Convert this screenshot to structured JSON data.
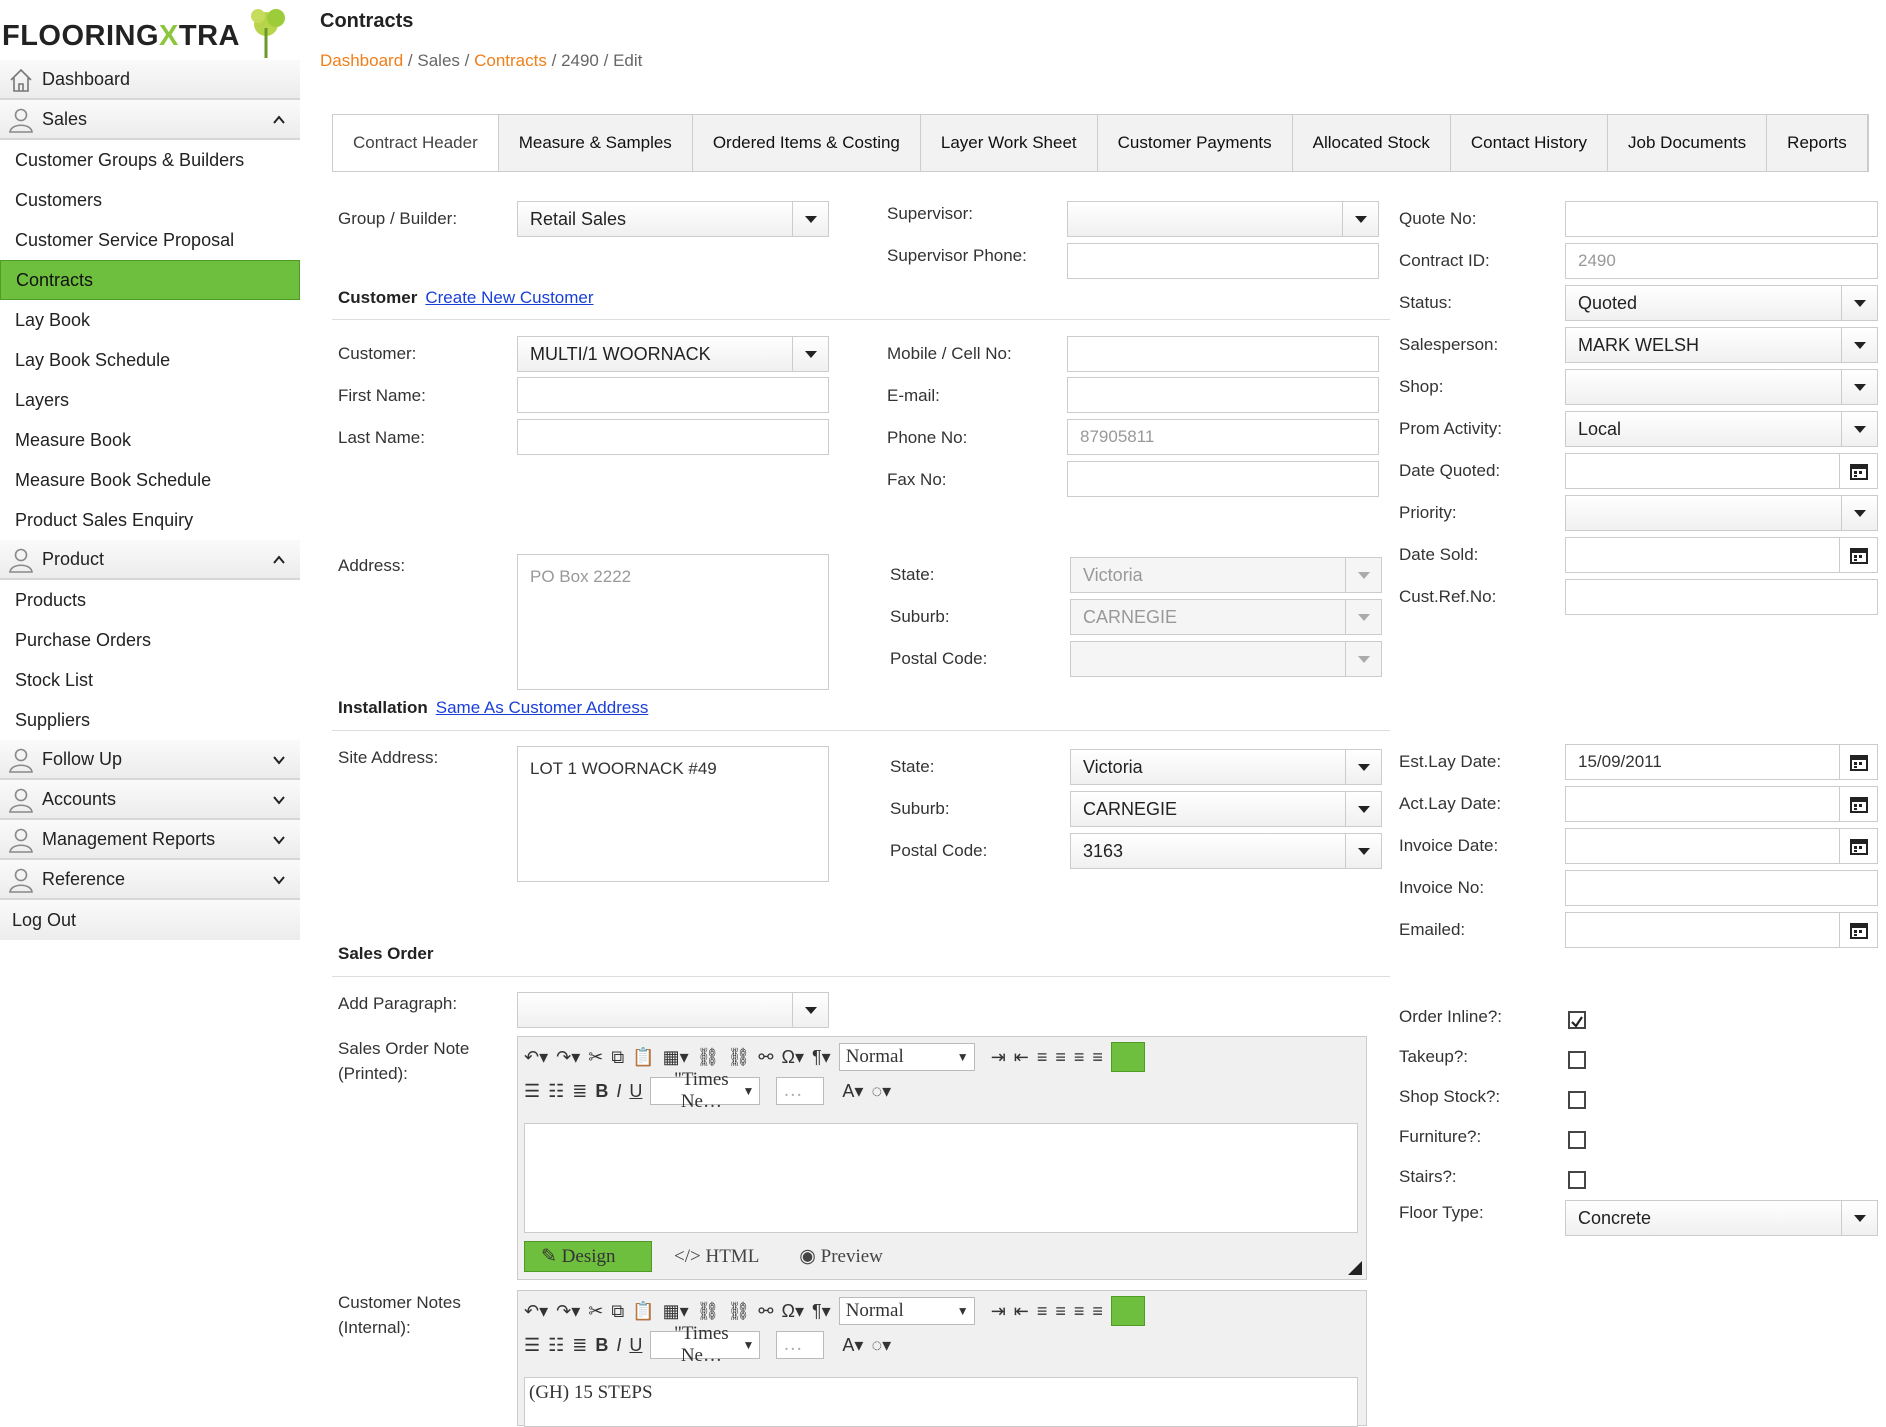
{
  "logo": {
    "part1": "FLOORING",
    "part2": "X",
    "part3": "TRA"
  },
  "nav": {
    "dashboard": "Dashboard",
    "sales": "Sales",
    "sales_items": [
      "Customer Groups & Builders",
      "Customers",
      "Customer Service Proposal",
      "Contracts",
      "Lay Book",
      "Lay Book Schedule",
      "Layers",
      "Measure Book",
      "Measure Book Schedule",
      "Product Sales Enquiry"
    ],
    "product": "Product",
    "product_items": [
      "Products",
      "Purchase Orders",
      "Stock List",
      "Suppliers"
    ],
    "follow_up": "Follow Up",
    "accounts": "Accounts",
    "management_reports": "Management Reports",
    "reference": "Reference",
    "logout": "Log Out"
  },
  "page": {
    "title": "Contracts"
  },
  "breadcrumb": {
    "dashboard": "Dashboard",
    "sep": "/",
    "sales": "Sales",
    "contracts": "Contracts",
    "id": "2490",
    "edit": "Edit"
  },
  "tabs": [
    "Contract Header",
    "Measure & Samples",
    "Ordered Items & Costing",
    "Layer Work Sheet",
    "Customer Payments",
    "Allocated Stock",
    "Contact History",
    "Job Documents",
    "Reports"
  ],
  "form": {
    "group_label": "Group / Builder:",
    "group_value": "Retail Sales",
    "supervisor_label": "Supervisor:",
    "supervisor_value": "",
    "supervisor_phone_label": "Supervisor Phone:",
    "supervisor_phone_value": "",
    "customer_section": "Customer",
    "create_customer_link": "Create New Customer",
    "customer_label": "Customer:",
    "customer_value": "MULTI/1 WOORNACK",
    "first_name_label": "First Name:",
    "first_name_value": "",
    "last_name_label": "Last Name:",
    "last_name_value": "",
    "mobile_label": "Mobile / Cell No:",
    "mobile_value": "",
    "email_label": "E-mail:",
    "email_value": "",
    "phone_label": "Phone No:",
    "phone_value": "87905811",
    "fax_label": "Fax No:",
    "fax_value": "",
    "address_label": "Address:",
    "address_value": "PO Box 2222",
    "state_label": "State:",
    "state_value": "Victoria",
    "suburb_label": "Suburb:",
    "suburb_value": "CARNEGIE",
    "postal_label": "Postal Code:",
    "postal_value": "",
    "installation_section": "Installation",
    "same_address_link": "Same As Customer Address",
    "site_address_label": "Site Address:",
    "site_address_value": "LOT 1 WOORNACK #49",
    "site_state_value": "Victoria",
    "site_suburb_value": "CARNEGIE",
    "site_postal_value": "3163",
    "sales_order_section": "Sales Order",
    "add_paragraph_label": "Add Paragraph:",
    "add_paragraph_value": "",
    "sales_order_note_label1": "Sales Order Note",
    "sales_order_note_label2": "(Printed):",
    "customer_notes_label1": "Customer Notes",
    "customer_notes_label2": "(Internal):",
    "customer_notes_text": "(GH) 15 STEPS"
  },
  "right": {
    "quote_no_label": "Quote No:",
    "quote_no_value": "",
    "contract_id_label": "Contract ID:",
    "contract_id_value": "2490",
    "status_label": "Status:",
    "status_value": "Quoted",
    "salesperson_label": "Salesperson:",
    "salesperson_value": "MARK WELSH",
    "shop_label": "Shop:",
    "shop_value": "",
    "prom_label": "Prom Activity:",
    "prom_value": "Local",
    "date_quoted_label": "Date Quoted:",
    "date_quoted_value": "",
    "priority_label": "Priority:",
    "priority_value": "",
    "date_sold_label": "Date Sold:",
    "date_sold_value": "",
    "cust_ref_label": "Cust.Ref.No:",
    "cust_ref_value": "",
    "est_lay_label": "Est.Lay Date:",
    "est_lay_value": "15/09/2011",
    "act_lay_label": "Act.Lay Date:",
    "act_lay_value": "",
    "invoice_date_label": "Invoice Date:",
    "invoice_date_value": "",
    "invoice_no_label": "Invoice No:",
    "invoice_no_value": "",
    "emailed_label": "Emailed:",
    "emailed_value": "",
    "order_inline_label": "Order Inline?:",
    "order_inline_checked": true,
    "takeup_label": "Takeup?:",
    "takeup_checked": false,
    "shop_stock_label": "Shop Stock?:",
    "shop_stock_checked": false,
    "furniture_label": "Furniture?:",
    "furniture_checked": false,
    "stairs_label": "Stairs?:",
    "stairs_checked": false,
    "floor_type_label": "Floor Type:",
    "floor_type_value": "Concrete"
  },
  "editor": {
    "format": "Normal",
    "font": "\"Times Ne…",
    "size": "…",
    "mode_design": "Design",
    "mode_html": "HTML",
    "mode_preview": "Preview"
  },
  "colors": {
    "accent": "#6fbf3e",
    "breadcrumb_link": "#f07f1a",
    "link": "#1a3fd8"
  }
}
